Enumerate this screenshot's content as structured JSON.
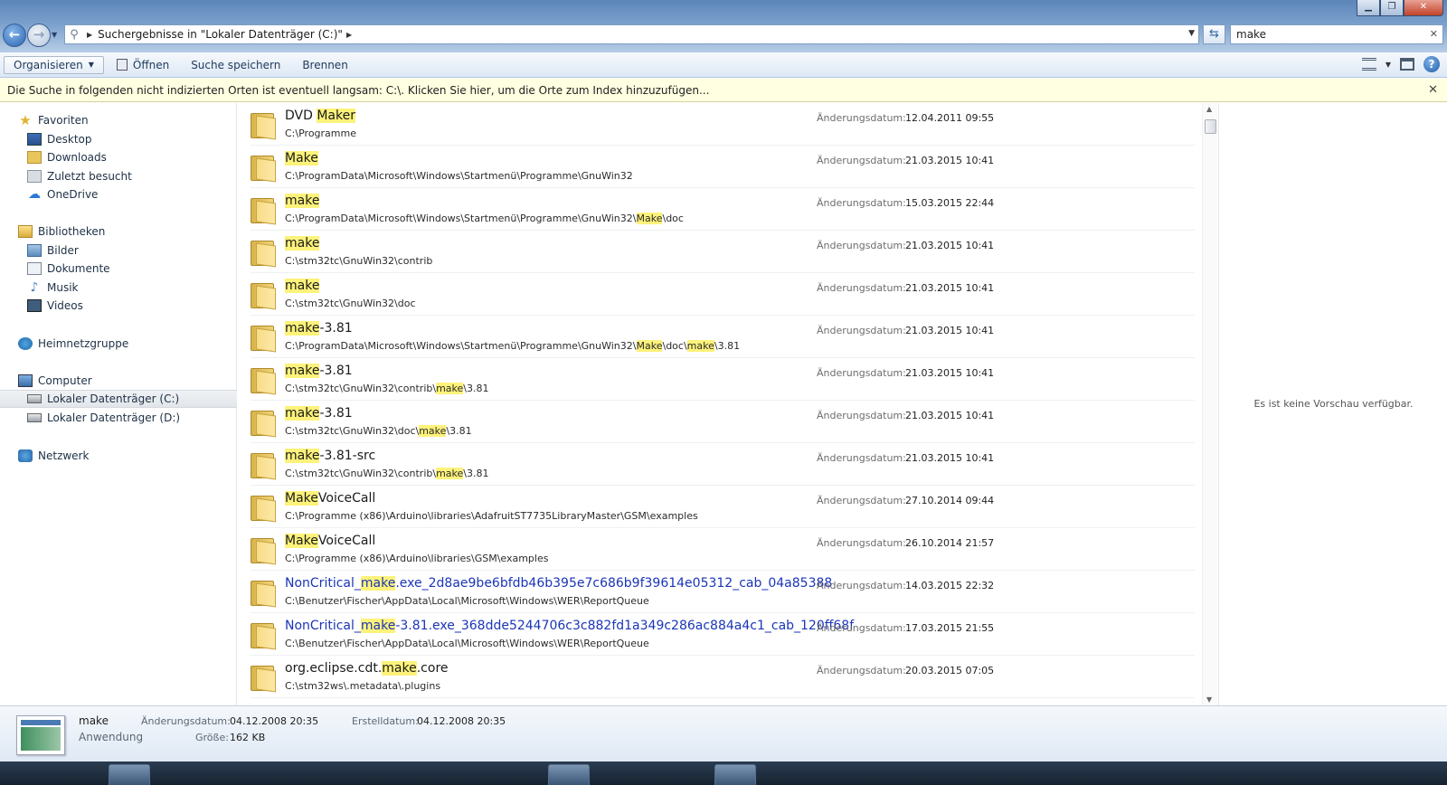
{
  "window": {
    "minimize_icon": "minimize-icon",
    "maximize_icon": "maximize-icon",
    "close_icon": "close-icon"
  },
  "address": {
    "path": "Suchergebnisse in \"Lokaler Datenträger (C:)\"",
    "search_value": "make"
  },
  "toolbar": {
    "organize": "Organisieren",
    "open": "Öffnen",
    "save_search": "Suche speichern",
    "burn": "Brennen"
  },
  "infobar": {
    "message": "Die Suche in folgenden nicht indizierten Orten ist eventuell langsam: C:\\. Klicken Sie hier, um die Orte zum Index hinzuzufügen..."
  },
  "sidebar": {
    "favorites": "Favoriten",
    "desktop": "Desktop",
    "downloads": "Downloads",
    "recent": "Zuletzt besucht",
    "onedrive": "OneDrive",
    "libraries": "Bibliotheken",
    "pictures": "Bilder",
    "documents": "Dokumente",
    "music": "Musik",
    "videos": "Videos",
    "homegroup": "Heimnetzgruppe",
    "computer": "Computer",
    "drive_c": "Lokaler Datenträger (C:)",
    "drive_d": "Lokaler Datenträger (D:)",
    "network": "Netzwerk"
  },
  "results": {
    "date_label": "Änderungsdatum:",
    "items": [
      {
        "name": [
          "DVD ",
          "|Maker"
        ],
        "path": [
          "C:\\Programme"
        ],
        "date": "12.04.2011 09:55",
        "link": false
      },
      {
        "name": [
          "|Make"
        ],
        "path": [
          "C:\\ProgramData\\Microsoft\\Windows\\Startmenü\\Programme\\GnuWin32"
        ],
        "date": "21.03.2015 10:41",
        "link": false
      },
      {
        "name": [
          "|make"
        ],
        "path": [
          "C:\\ProgramData\\Microsoft\\Windows\\Startmenü\\Programme\\GnuWin32\\",
          "|Make",
          "\\doc"
        ],
        "date": "15.03.2015 22:44",
        "link": false
      },
      {
        "name": [
          "|make"
        ],
        "path": [
          "C:\\stm32tc\\GnuWin32\\contrib"
        ],
        "date": "21.03.2015 10:41",
        "link": false
      },
      {
        "name": [
          "|make"
        ],
        "path": [
          "C:\\stm32tc\\GnuWin32\\doc"
        ],
        "date": "21.03.2015 10:41",
        "link": false
      },
      {
        "name": [
          "|make",
          "-3.81"
        ],
        "path": [
          "C:\\ProgramData\\Microsoft\\Windows\\Startmenü\\Programme\\GnuWin32\\",
          "|Make",
          "\\doc\\",
          "|make",
          "\\3.81"
        ],
        "date": "21.03.2015 10:41",
        "link": false
      },
      {
        "name": [
          "|make",
          "-3.81"
        ],
        "path": [
          "C:\\stm32tc\\GnuWin32\\contrib\\",
          "|make",
          "\\3.81"
        ],
        "date": "21.03.2015 10:41",
        "link": false
      },
      {
        "name": [
          "|make",
          "-3.81"
        ],
        "path": [
          "C:\\stm32tc\\GnuWin32\\doc\\",
          "|make",
          "\\3.81"
        ],
        "date": "21.03.2015 10:41",
        "link": false
      },
      {
        "name": [
          "|make",
          "-3.81-src"
        ],
        "path": [
          "C:\\stm32tc\\GnuWin32\\contrib\\",
          "|make",
          "\\3.81"
        ],
        "date": "21.03.2015 10:41",
        "link": false
      },
      {
        "name": [
          "|Make",
          "VoiceCall"
        ],
        "path": [
          "C:\\Programme (x86)\\Arduino\\libraries\\AdafruitST7735LibraryMaster\\GSM\\examples"
        ],
        "date": "27.10.2014 09:44",
        "link": false
      },
      {
        "name": [
          "|Make",
          "VoiceCall"
        ],
        "path": [
          "C:\\Programme (x86)\\Arduino\\libraries\\GSM\\examples"
        ],
        "date": "26.10.2014 21:57",
        "link": false
      },
      {
        "name": [
          "NonCritical_",
          "|make",
          ".exe_2d8ae9be6bfdb46b395e7c686b9f39614e05312_cab_04a85388"
        ],
        "path": [
          "C:\\Benutzer\\Fischer\\AppData\\Local\\Microsoft\\Windows\\WER\\ReportQueue"
        ],
        "date": "14.03.2015 22:32",
        "link": true
      },
      {
        "name": [
          "NonCritical_",
          "|make",
          "-3.81.exe_368dde5244706c3c882fd1a349c286ac884a4c1_cab_120ff68f"
        ],
        "path": [
          "C:\\Benutzer\\Fischer\\AppData\\Local\\Microsoft\\Windows\\WER\\ReportQueue"
        ],
        "date": "17.03.2015 21:55",
        "link": true
      },
      {
        "name": [
          "org.eclipse.cdt.",
          "|make",
          ".core"
        ],
        "path": [
          "C:\\stm32ws\\.metadata\\.plugins"
        ],
        "date": "20.03.2015 07:05",
        "link": false
      }
    ]
  },
  "preview": {
    "message": "Es ist keine Vorschau verfügbar."
  },
  "details": {
    "name": "make",
    "type": "Anwendung",
    "modified_label": "Änderungsdatum:",
    "modified_value": "04.12.2008 20:35",
    "size_label": "Größe:",
    "size_value": "162 KB",
    "created_label": "Erstelldatum:",
    "created_value": "04.12.2008 20:35"
  }
}
